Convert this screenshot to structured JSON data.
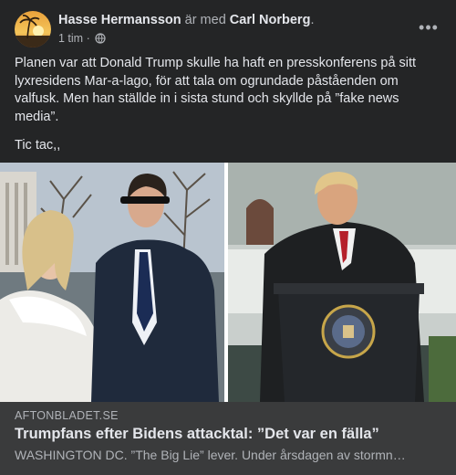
{
  "post": {
    "author": "Hasse Hermansson",
    "with_text": "är med",
    "tagged": "Carl Norberg",
    "tagged_suffix": ".",
    "time": "1 tim",
    "time_sep": "·",
    "privacy_icon": "globe-icon",
    "more_icon": "more-options-icon",
    "more_label": "•••",
    "paragraph1": "Planen var att Donald Trump skulle ha haft en presskonferens på sitt lyxresidens Mar-a-lago, för att tala om ogrundade påståenden om valfusk. Men han ställde in i sista stund och skyllde på ”fake news media”.",
    "paragraph2": "Tic tac,,"
  },
  "link_preview": {
    "domain": "AFTONBLADET.SE",
    "headline": "Trumpfans efter Bidens attacktal: ”Det var en fälla”",
    "description": "WASHINGTON DC. ”The Big Lie” lever. Under årsdagen av stormn…"
  },
  "colors": {
    "card_bg": "#242526",
    "link_bg": "#3a3b3c",
    "primary_text": "#e4e6eb",
    "secondary_text": "#b0b3b8"
  }
}
